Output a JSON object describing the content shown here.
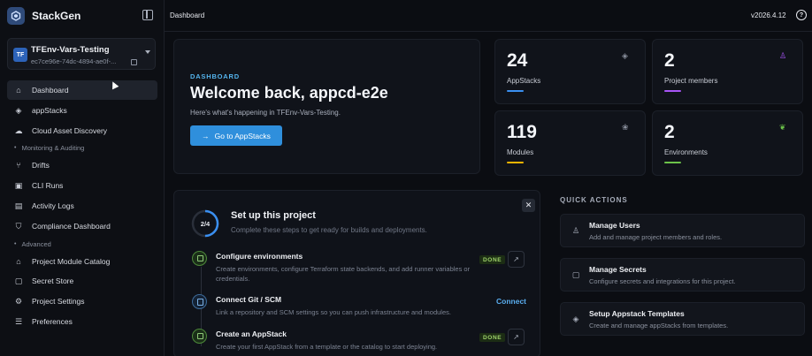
{
  "app": {
    "name": "StackGen",
    "version": "v2026.4.12"
  },
  "project": {
    "badge": "TF",
    "name": "TFEnv-Vars-Testing",
    "id": "ec7ce96e-74dc-4894-ae0f-..."
  },
  "sidebar": {
    "items": [
      {
        "label": "Dashboard",
        "icon": "home-icon"
      },
      {
        "label": "appStacks",
        "icon": "layers-icon"
      },
      {
        "label": "Cloud Asset Discovery",
        "icon": "cloud-icon"
      }
    ],
    "section_monitoring": "Monitoring & Auditing",
    "monitoring_items": [
      {
        "label": "Drifts",
        "icon": "branch-icon"
      },
      {
        "label": "CLI Runs",
        "icon": "terminal-icon"
      },
      {
        "label": "Activity Logs",
        "icon": "log-icon"
      },
      {
        "label": "Compliance Dashboard",
        "icon": "shield-icon"
      }
    ],
    "section_advanced": "Advanced",
    "advanced_items": [
      {
        "label": "Project Module Catalog",
        "icon": "catalog-icon"
      },
      {
        "label": "Secret Store",
        "icon": "lock-icon"
      },
      {
        "label": "Project Settings",
        "icon": "gear-icon"
      },
      {
        "label": "Preferences",
        "icon": "sliders-icon"
      }
    ]
  },
  "topbar": {
    "breadcrumb": "Dashboard",
    "help": "?"
  },
  "welcome": {
    "kicker": "DASHBOARD",
    "title": "Welcome back, appcd-e2e",
    "subtitle": "Here's what's happening in TFEnv-Vars-Testing.",
    "button": "Go to AppStacks"
  },
  "stats": [
    {
      "value": "24",
      "label": "AppStacks",
      "color": "#3a8ff0",
      "icon": "layers-icon"
    },
    {
      "value": "2",
      "label": "Project members",
      "color": "#a855f7",
      "icon": "user-icon"
    },
    {
      "value": "119",
      "label": "Modules",
      "color": "#f5b400",
      "icon": "modules-icon"
    },
    {
      "value": "2",
      "label": "Environments",
      "color": "#6cc24a",
      "icon": "leaf-icon"
    }
  ],
  "setup": {
    "progress": "2/4",
    "progress_fraction": 0.5,
    "title": "Set up this project",
    "subtitle": "Complete these steps to get ready for builds and deployments.",
    "close": "✕",
    "steps": [
      {
        "title": "Configure environments",
        "desc": "Create environments, configure Terraform state backends, and add runner variables or credentials.",
        "status": "DONE"
      },
      {
        "title": "Connect Git / SCM",
        "desc": "Link a repository and SCM settings so you can push infrastructure and modules.",
        "action": "Connect"
      },
      {
        "title": "Create an AppStack",
        "desc": "Create your first AppStack from a template or the catalog to start deploying.",
        "status": "DONE"
      }
    ]
  },
  "quick_actions": {
    "title": "QUICK ACTIONS",
    "items": [
      {
        "name": "Manage Users",
        "desc": "Add and manage project members and roles.",
        "icon": "user-icon"
      },
      {
        "name": "Manage Secrets",
        "desc": "Configure secrets and integrations for this project.",
        "icon": "lock-icon"
      },
      {
        "name": "Setup Appstack Templates",
        "desc": "Create and manage appStacks from templates.",
        "icon": "layers-icon"
      }
    ]
  }
}
